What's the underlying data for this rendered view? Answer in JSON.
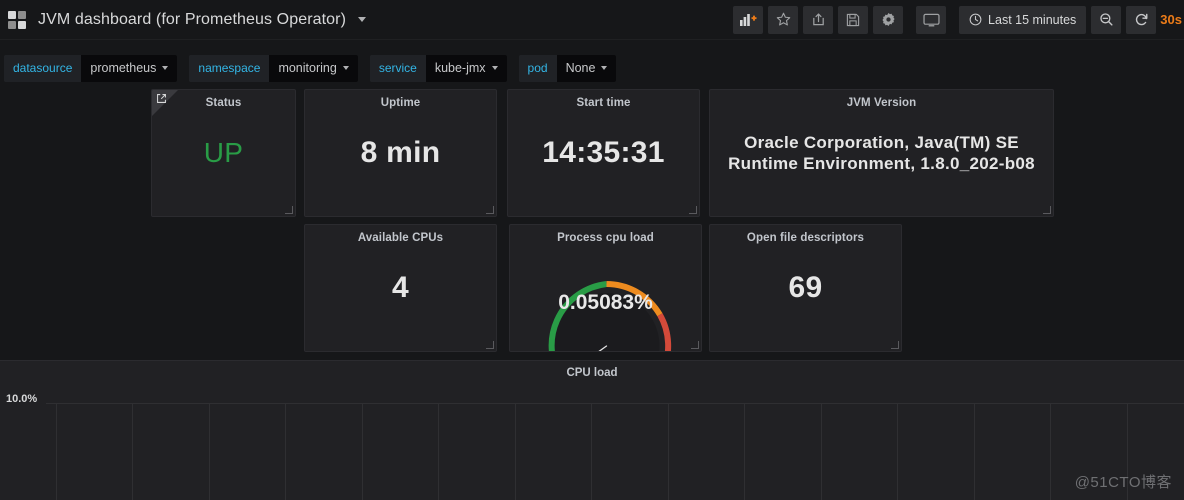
{
  "navbar": {
    "logo_icon": "grafana-squares-icon",
    "title": "JVM dashboard (for Prometheus Operator)",
    "dropdown_icon": "chevron-down-icon",
    "buttons": [
      {
        "name": "add-panel-button",
        "icon": "bar-chart-plus-icon"
      },
      {
        "name": "star-button",
        "icon": "star-icon"
      },
      {
        "name": "share-button",
        "icon": "share-icon"
      },
      {
        "name": "save-button",
        "icon": "save-disk-icon"
      },
      {
        "name": "settings-button",
        "icon": "gear-icon"
      },
      {
        "name": "kiosk-mode-button",
        "icon": "monitor-icon"
      }
    ],
    "time_range": "Last 15 minutes",
    "time_icon": "clock-icon",
    "zoom_out_icon": "magnifier-minus-icon",
    "refresh_icon": "refresh-icon",
    "refresh_interval": "30s",
    "accent_orange": "#eb7b18"
  },
  "variables": [
    {
      "label": "datasource",
      "value": "prometheus"
    },
    {
      "label": "namespace",
      "value": "monitoring"
    },
    {
      "label": "service",
      "value": "kube-jmx"
    },
    {
      "label": "pod",
      "value": "None"
    }
  ],
  "panels": {
    "status": {
      "title": "Status",
      "value": "UP",
      "value_color": "#299c46",
      "link_icon": "external-link-icon"
    },
    "uptime": {
      "title": "Uptime",
      "value": "8 min"
    },
    "start_time": {
      "title": "Start time",
      "value": "14:35:31"
    },
    "jvm_version": {
      "title": "JVM Version",
      "value": "Oracle Corporation, Java(TM) SE Runtime Environment, 1.8.0_202-b08"
    },
    "cpus": {
      "title": "Available CPUs",
      "value": "4"
    },
    "cpu_load": {
      "title": "Process cpu load",
      "value": "0.05083%"
    },
    "file_desc": {
      "title": "Open file descriptors",
      "value": "69"
    }
  },
  "gauge": {
    "colors": {
      "green": "#299c46",
      "orange": "#ed8b1f",
      "red": "#d44a3a"
    },
    "value_percent": 0.05083
  },
  "graph": {
    "title": "CPU load",
    "y_ticks": [
      "10.0%"
    ],
    "gridline_count": 15
  },
  "watermark": "@51CTO博客",
  "chart_data": {
    "type": "line",
    "title": "CPU load",
    "xlabel": "",
    "ylabel": "",
    "ylim": [
      0,
      10
    ],
    "y_tick_labels": [
      "10.0%"
    ],
    "grid": true,
    "legend": "none",
    "series": [
      {
        "name": "cpu load",
        "values": []
      }
    ],
    "note": "Plot area is empty in the visible crop; only gridlines and the 10.0% y-axis tick are rendered."
  }
}
